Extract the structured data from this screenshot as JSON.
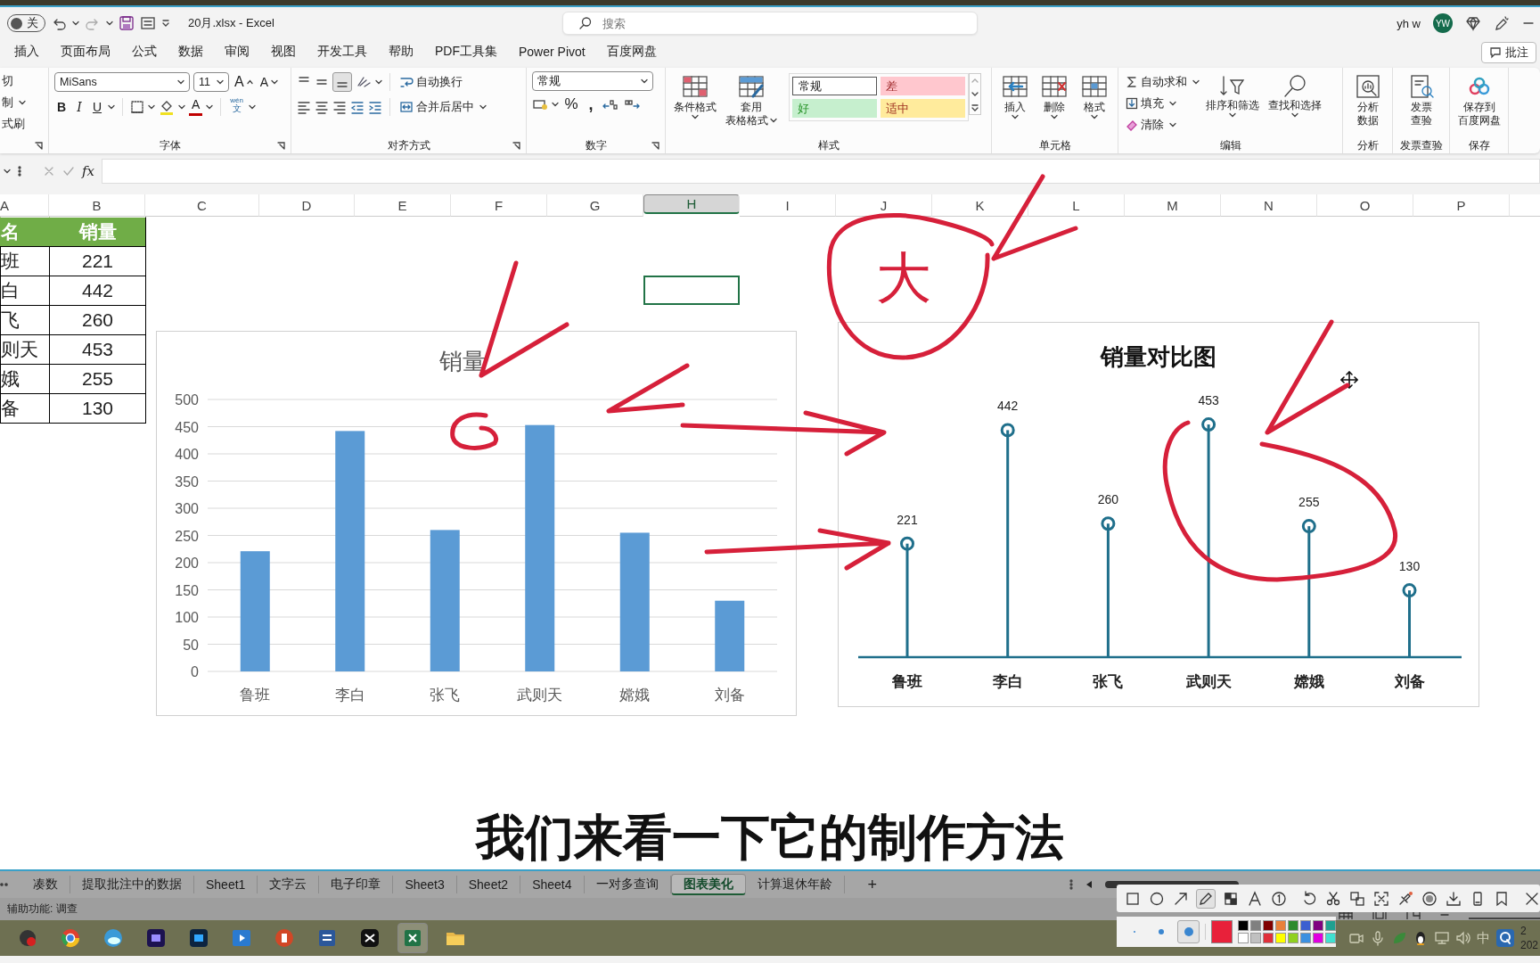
{
  "title_bar": {
    "autosave_label": "关",
    "autosave_on": false,
    "file_title": "20月.xlsx - Excel",
    "search_placeholder": "搜索",
    "user_name": "yh w",
    "avatar_initials": "YW"
  },
  "menu_tabs": [
    {
      "label": "插入",
      "selected": false
    },
    {
      "label": "页面布局",
      "selected": false
    },
    {
      "label": "公式",
      "selected": false
    },
    {
      "label": "数据",
      "selected": false
    },
    {
      "label": "审阅",
      "selected": false
    },
    {
      "label": "视图",
      "selected": false
    },
    {
      "label": "开发工具",
      "selected": false
    },
    {
      "label": "帮助",
      "selected": false
    },
    {
      "label": "PDF工具集",
      "selected": false
    },
    {
      "label": "Power Pivot",
      "selected": false
    },
    {
      "label": "百度网盘",
      "selected": false
    }
  ],
  "comment_button": "批注",
  "ribbon": {
    "clipboard": {
      "items": [
        "切",
        "制",
        "式刷"
      ]
    },
    "font": {
      "title": "字体",
      "font_name": "MiSans",
      "font_size": "11",
      "grow_font": "A",
      "shrink_font": "A",
      "style_buttons": [
        "B",
        "I",
        "U"
      ],
      "font_color": "A",
      "phonetic": [
        "wén",
        "文"
      ]
    },
    "alignment": {
      "title": "对齐方式",
      "wrap_text": "自动换行",
      "merge_center": "合并后居中"
    },
    "number": {
      "title": "数字",
      "format": "常规",
      "percent": "%",
      "comma": ","
    },
    "styles": {
      "title": "样式",
      "conditional_format": "条件格式",
      "table_format_lines": [
        "套用",
        "表格格式"
      ],
      "cell_styles": [
        {
          "label": "常规",
          "color": "#ffffff"
        },
        {
          "label": "差",
          "color": "#ffc7ce"
        },
        {
          "label": "好",
          "color": "#c6efce"
        },
        {
          "label": "适中",
          "color": "#ffeb9c"
        }
      ]
    },
    "cells": {
      "title": "单元格",
      "buttons": [
        "插入",
        "删除",
        "格式"
      ]
    },
    "editing": {
      "title": "编辑",
      "autosum": "自动求和",
      "fill": "填充",
      "clear": "清除",
      "sort_filter": "排序和筛选",
      "find_select": "查找和选择"
    },
    "analysis": {
      "title": "分析",
      "button_lines": [
        "分析",
        "数据"
      ]
    },
    "invoice": {
      "title": "发票查验",
      "button_lines": [
        "发票",
        "查验"
      ]
    },
    "save": {
      "title": "保存",
      "button_lines": [
        "保存到",
        "百度网盘"
      ]
    }
  },
  "formula_bar": {
    "function_label": "fx"
  },
  "columns": [
    {
      "label": "A",
      "selected": false
    },
    {
      "label": "B",
      "selected": false
    },
    {
      "label": "C",
      "selected": false
    },
    {
      "label": "D",
      "selected": false
    },
    {
      "label": "E",
      "selected": false
    },
    {
      "label": "F",
      "selected": false
    },
    {
      "label": "G",
      "selected": false
    },
    {
      "label": "H",
      "selected": true
    },
    {
      "label": "I",
      "selected": false
    },
    {
      "label": "J",
      "selected": false
    },
    {
      "label": "K",
      "selected": false
    },
    {
      "label": "L",
      "selected": false
    },
    {
      "label": "M",
      "selected": false
    },
    {
      "label": "N",
      "selected": false
    },
    {
      "label": "O",
      "selected": false
    },
    {
      "label": "P",
      "selected": false
    }
  ],
  "table": {
    "header": [
      "名",
      "销量"
    ],
    "rows": [
      [
        "班",
        "221"
      ],
      [
        "白",
        "442"
      ],
      [
        "飞",
        "260"
      ],
      [
        "则天",
        "453"
      ],
      [
        "娥",
        "255"
      ],
      [
        "备",
        "130"
      ]
    ]
  },
  "charts": [
    {
      "chart_data": {
        "type": "bar",
        "title": "销量",
        "categories": [
          "鲁班",
          "李白",
          "张飞",
          "武则天",
          "嫦娥",
          "刘备"
        ],
        "grid": true,
        "series": [
          {
            "color": "#5b9bd5",
            "values": [
              221,
              442,
              260,
              453,
              255,
              130
            ]
          }
        ],
        "ylim": [
          0,
          500
        ],
        "yticks": [
          0,
          50,
          100,
          150,
          200,
          250,
          300,
          350,
          400,
          450,
          500
        ]
      }
    },
    {
      "chart_data": {
        "type": "bar",
        "title": "销量对比图",
        "marker": "circle",
        "categories": [
          "鲁班",
          "李白",
          "张飞",
          "武则天",
          "嫦娥",
          "刘备"
        ],
        "series": [
          {
            "color": "#1f6f8b",
            "values": [
              221,
              442,
              260,
              453,
              255,
              130
            ]
          }
        ],
        "data_labels": true
      }
    }
  ],
  "annotations": {
    "circled_text": "大"
  },
  "subtitle": "我们来看一下它的制作方法",
  "sheet_tabs": [
    {
      "label": "凑数",
      "selected": false
    },
    {
      "label": "提取批注中的数据",
      "selected": false
    },
    {
      "label": "Sheet1",
      "selected": false
    },
    {
      "label": "文字云",
      "selected": false
    },
    {
      "label": "电子印章",
      "selected": false
    },
    {
      "label": "Sheet3",
      "selected": false
    },
    {
      "label": "Sheet2",
      "selected": false
    },
    {
      "label": "Sheet4",
      "selected": false
    },
    {
      "label": "一对多查询",
      "selected": false
    },
    {
      "label": "图表美化",
      "selected": true
    },
    {
      "label": "计算退休年龄",
      "selected": false
    }
  ],
  "add_sheet": "+",
  "status_bar": {
    "text": "辅助功能: 调查"
  },
  "markup_toolbar": {
    "tools": [
      {
        "selected": false
      },
      {
        "selected": false
      },
      {
        "selected": false
      },
      {
        "selected": true
      },
      {
        "selected": false
      },
      {
        "selected": false
      },
      {
        "selected": false
      },
      {
        "selected": false
      },
      {
        "selected": false
      },
      {
        "selected": false
      },
      {
        "selected": false
      },
      {
        "selected": false
      },
      {
        "selected": false
      },
      {
        "selected": false
      },
      {
        "selected": false
      },
      {
        "selected": false
      },
      {
        "selected": false
      }
    ],
    "pen_sizes": [
      {
        "selected": false
      },
      {
        "selected": false
      },
      {
        "selected": true
      }
    ],
    "current_color": {
      "color": "#e8213a"
    },
    "palette": [
      {
        "color": "#000000"
      },
      {
        "color": "#808080"
      },
      {
        "color": "#800000"
      },
      {
        "color": "#e8803a"
      },
      {
        "color": "#2e8b2e"
      },
      {
        "color": "#3c5fd0"
      },
      {
        "color": "#800080"
      },
      {
        "color": "#20a090"
      },
      {
        "color": "#ffffff"
      },
      {
        "color": "#c0c0c0"
      },
      {
        "color": "#e0303a"
      },
      {
        "color": "#ffff00"
      },
      {
        "color": "#90d020"
      },
      {
        "color": "#3c90e0"
      },
      {
        "color": "#e000e0"
      },
      {
        "color": "#40e0d0"
      }
    ]
  },
  "taskbar": {
    "apps": [
      {
        "selected": false
      },
      {
        "selected": false
      },
      {
        "selected": false
      },
      {
        "selected": false
      },
      {
        "selected": false
      },
      {
        "selected": false
      },
      {
        "selected": false
      },
      {
        "selected": false
      },
      {
        "selected": false
      },
      {
        "selected": true
      },
      {
        "selected": false
      }
    ],
    "ime": "中",
    "clock_lines": [
      "2",
      "202"
    ]
  }
}
